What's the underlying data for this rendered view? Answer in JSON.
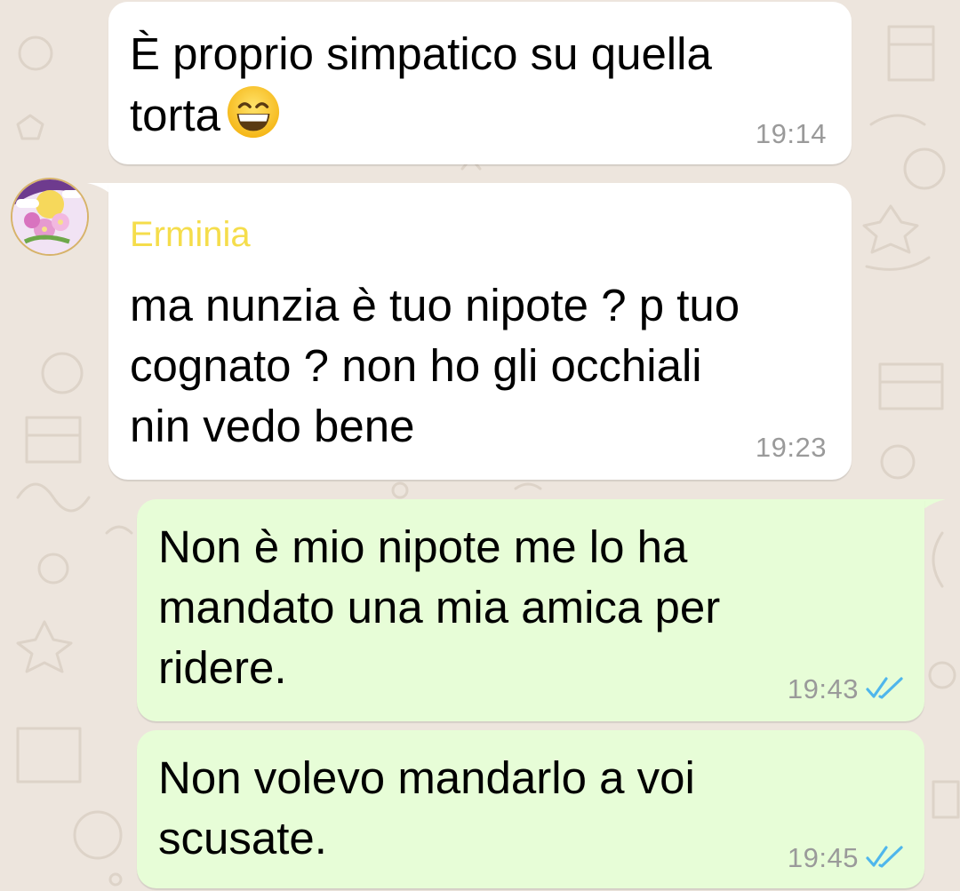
{
  "chat": {
    "messages": [
      {
        "direction": "incoming",
        "text": "È proprio simpatico su quella",
        "text_line2": "torta",
        "emoji": "grinning-face-with-smiling-eyes-icon",
        "time": "19:14"
      },
      {
        "direction": "incoming",
        "sender": "Erminia",
        "sender_color": "#f5dd4b",
        "text": "ma nunzia è tuo nipote ? p tuo\ncognato ? non ho gli occhiali\nnin vedo bene",
        "time": "19:23",
        "avatar": "sender-avatar-flowers"
      },
      {
        "direction": "outgoing",
        "text": "Non è mio nipote me lo ha\nmandato una mia amica per\nridere.",
        "time": "19:43",
        "status": "read-double-check-icon"
      },
      {
        "direction": "outgoing",
        "text": "Non volevo mandarlo a voi\nscusate.",
        "time": "19:45",
        "status": "read-double-check-icon"
      }
    ]
  },
  "colors": {
    "background": "#ede5dd",
    "incoming_bubble": "#ffffff",
    "outgoing_bubble": "#e7fdd7",
    "read_ticks": "#4fb6ec",
    "timestamp": "#9a9a9a"
  }
}
